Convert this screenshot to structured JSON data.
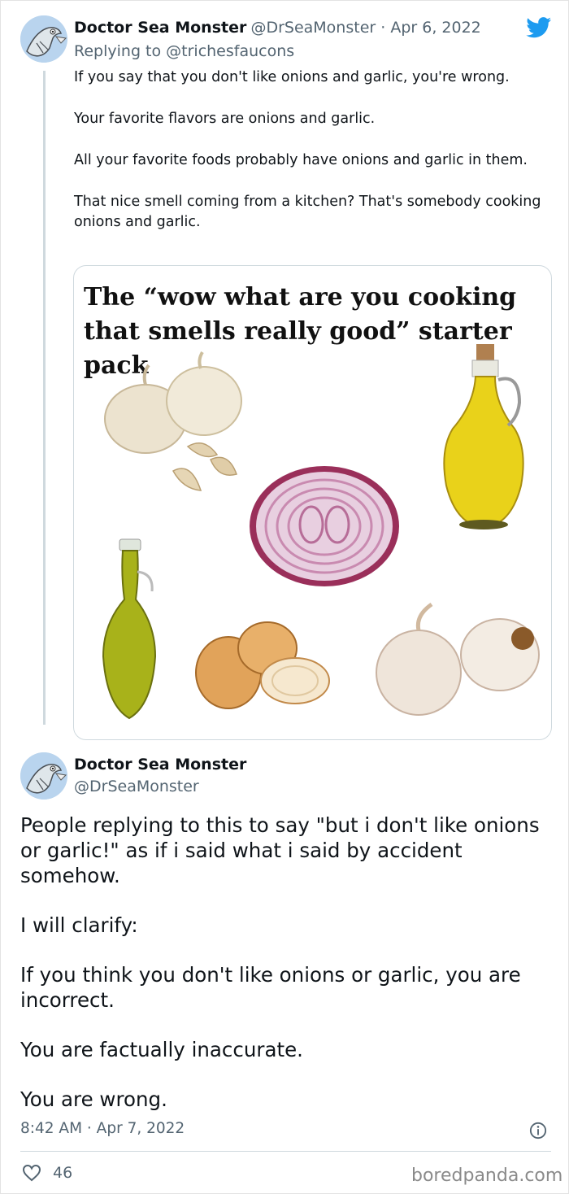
{
  "tweet1": {
    "author_name": "Doctor Sea Monster",
    "author_handle": "@DrSeaMonster",
    "date": "Apr 6, 2022",
    "replying_prefix": "Replying to ",
    "replying_to": "@trichesfaucons",
    "paragraphs": [
      "If you say that you don't like onions and garlic, you're wrong.",
      "Your favorite flavors are onions and garlic.",
      "All your favorite foods probably have onions and garlic in them.",
      "That nice smell coming from a kitchen? That's somebody cooking onions and garlic."
    ],
    "media": {
      "title": "The “wow what are you cooking that smells really good” starter pack",
      "items": [
        "garlic-bulbs",
        "olive-oil-bottle",
        "red-onion-slice",
        "olive-oil-carafe",
        "yellow-onions",
        "garlic-heads"
      ]
    }
  },
  "tweet2": {
    "author_name": "Doctor Sea Monster",
    "author_handle": "@DrSeaMonster",
    "paragraphs": [
      "People replying to this to say \"but i don't like onions or garlic!\" as if i said what i said by accident somehow.",
      "I will clarify:",
      "If you think you don't like onions or garlic, you are incorrect.",
      "You are factually inaccurate.",
      "You are wrong."
    ],
    "timestamp": "8:42 AM · Apr 7, 2022",
    "like_count": "46"
  },
  "watermark": "boredpanda.com",
  "colors": {
    "twitter_blue": "#1d9bf0",
    "secondary_text": "#536471",
    "primary_text": "#0f1419",
    "border": "#cfd9de"
  },
  "icons": [
    "twitter-bird-icon",
    "info-icon",
    "heart-icon"
  ]
}
